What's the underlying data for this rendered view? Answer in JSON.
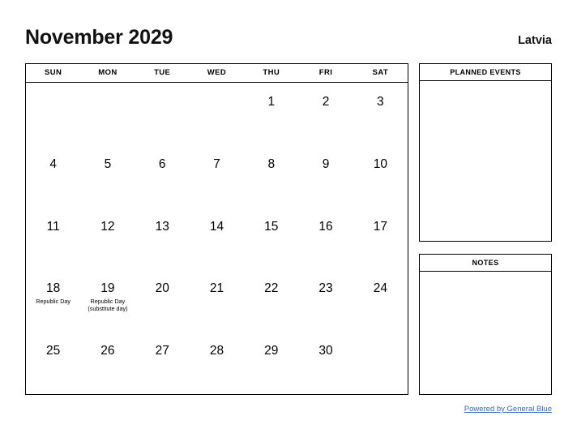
{
  "header": {
    "title": "November 2029",
    "country": "Latvia"
  },
  "calendar": {
    "weekdays": [
      "SUN",
      "MON",
      "TUE",
      "WED",
      "THU",
      "FRI",
      "SAT"
    ],
    "weeks": [
      [
        {
          "day": "",
          "event": ""
        },
        {
          "day": "",
          "event": ""
        },
        {
          "day": "",
          "event": ""
        },
        {
          "day": "",
          "event": ""
        },
        {
          "day": "1",
          "event": ""
        },
        {
          "day": "2",
          "event": ""
        },
        {
          "day": "3",
          "event": ""
        }
      ],
      [
        {
          "day": "4",
          "event": ""
        },
        {
          "day": "5",
          "event": ""
        },
        {
          "day": "6",
          "event": ""
        },
        {
          "day": "7",
          "event": ""
        },
        {
          "day": "8",
          "event": ""
        },
        {
          "day": "9",
          "event": ""
        },
        {
          "day": "10",
          "event": ""
        }
      ],
      [
        {
          "day": "11",
          "event": ""
        },
        {
          "day": "12",
          "event": ""
        },
        {
          "day": "13",
          "event": ""
        },
        {
          "day": "14",
          "event": ""
        },
        {
          "day": "15",
          "event": ""
        },
        {
          "day": "16",
          "event": ""
        },
        {
          "day": "17",
          "event": ""
        }
      ],
      [
        {
          "day": "18",
          "event": "Republic Day"
        },
        {
          "day": "19",
          "event": "Republic Day\n(substitute day)"
        },
        {
          "day": "20",
          "event": ""
        },
        {
          "day": "21",
          "event": ""
        },
        {
          "day": "22",
          "event": ""
        },
        {
          "day": "23",
          "event": ""
        },
        {
          "day": "24",
          "event": ""
        }
      ],
      [
        {
          "day": "25",
          "event": ""
        },
        {
          "day": "26",
          "event": ""
        },
        {
          "day": "27",
          "event": ""
        },
        {
          "day": "28",
          "event": ""
        },
        {
          "day": "29",
          "event": ""
        },
        {
          "day": "30",
          "event": ""
        },
        {
          "day": "",
          "event": ""
        }
      ]
    ]
  },
  "panels": {
    "planned_events": {
      "title": "PLANNED EVENTS",
      "content": ""
    },
    "notes": {
      "title": "NOTES",
      "content": ""
    }
  },
  "footer": {
    "link_label": "Powered by General Blue",
    "link_color": "#3465c4"
  }
}
